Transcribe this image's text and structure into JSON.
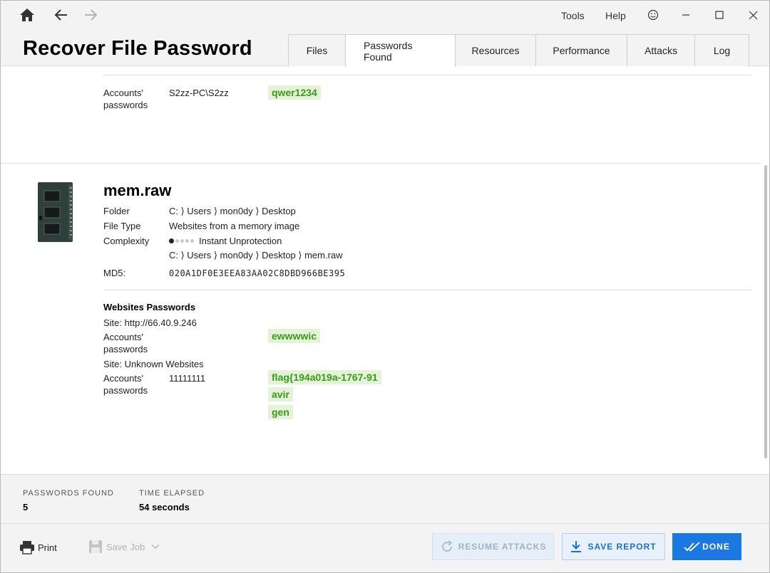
{
  "window": {
    "menu": {
      "tools": "Tools",
      "help": "Help"
    },
    "title": "Recover File Password"
  },
  "tabs": [
    "Files",
    "Passwords Found",
    "Resources",
    "Performance",
    "Attacks",
    "Log"
  ],
  "active_tab": "Passwords Found",
  "prev_entry": {
    "label_line1": "Accounts'",
    "label_line2": "passwords",
    "account": "S2zz-PC\\S2zz",
    "password": "qwer1234"
  },
  "file": {
    "name": "mem.raw",
    "folder_label": "Folder",
    "folder_value": "C: ⟩ Users ⟩ mon0dy ⟩ Desktop",
    "type_label": "File Type",
    "type_value": "Websites from a memory image",
    "complexity_label": "Complexity",
    "complexity_value": "Instant Unprotection",
    "complexity_level": 1,
    "complexity_max": 5,
    "path_value": "C: ⟩ Users ⟩ mon0dy ⟩ Desktop ⟩ mem.raw",
    "md5_label": "MD5:",
    "md5_value": "020A1DF0E3EEA83AA02C8DBD966BE395"
  },
  "websites": {
    "title": "Websites Passwords",
    "site1": "Site: http://66.40.9.246",
    "site1_label_line1": "Accounts'",
    "site1_label_line2": "passwords",
    "site1_password": "ewwwwic",
    "site2": "Site: Unknown Websites",
    "site2_label_line1": "Accounts'",
    "site2_label_line2": "passwords",
    "site2_account": "11111111",
    "site2_passwords": [
      "flag{194a019a-1767-91",
      "avir",
      "gen"
    ]
  },
  "stats": {
    "found_label": "PASSWORDS FOUND",
    "found_value": "5",
    "elapsed_label": "TIME ELAPSED",
    "elapsed_value": "54 seconds"
  },
  "footer": {
    "print": "Print",
    "save_job": "Save Job",
    "resume": "RESUME ATTACKS",
    "save_report": "SAVE REPORT",
    "done": "DONE"
  },
  "colors": {
    "password_text": "#3a9a1a",
    "password_bg": "#e4f2d8",
    "primary": "#1a78e0"
  }
}
